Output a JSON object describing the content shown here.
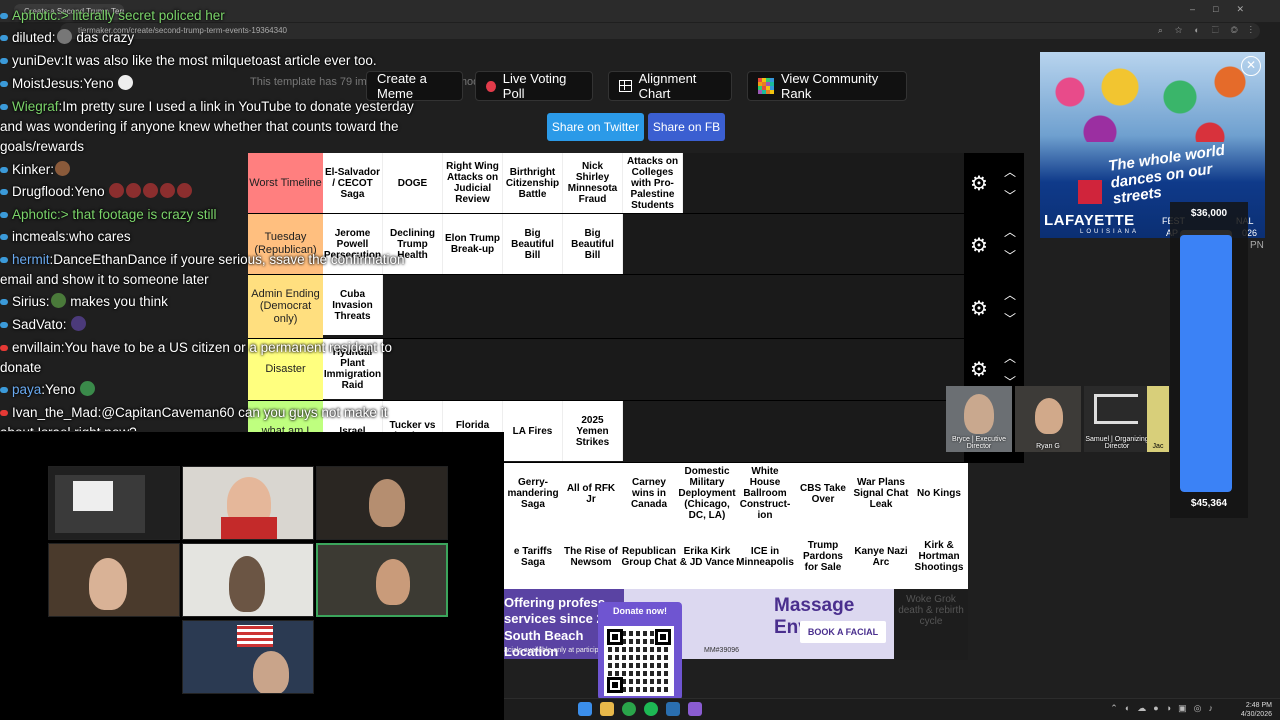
{
  "browser": {
    "tab_title": "Create a Second Trump Term E...",
    "url": "tiermaker.com/create/second-trump-term-events-19364340"
  },
  "page": {
    "template_note": "This template has 79 images and was last modified 04/10/2026.",
    "buttons": {
      "create_meme": "Create a Meme",
      "live_voting": "Live Voting Poll",
      "alignment_chart": "Alignment Chart",
      "community_rank": "View Community Rank",
      "share_twitter": "Share on Twitter",
      "share_fb": "Share on FB"
    },
    "tiers": [
      {
        "label": "Worst Timeline",
        "color": "#ff7f7f",
        "items": [
          "El-Salvador / CECOT Saga",
          "DOGE",
          "Right Wing Attacks on Judicial Review",
          "Birthright Citizenship Battle",
          "Nick Shirley Minnesota Fraud",
          "Attacks on Colleges with Pro-Palestine Students"
        ]
      },
      {
        "label": "Tuesday (Republican)",
        "color": "#ffbf7f",
        "items": [
          "Jerome Powell Persecution",
          "Declining Trump Health",
          "Elon Trump Break-up",
          "Big Beautiful Bill",
          "Big Beautiful Bill"
        ]
      },
      {
        "label": "Admin Ending (Democrat only)",
        "color": "#ffdf7f",
        "items": [
          "Cuba Invasion Threats"
        ]
      },
      {
        "label": "Disaster",
        "color": "#ffff7f",
        "items": [
          "Hyundai Plant Immigration Raid"
        ]
      },
      {
        "label": "what am I",
        "color": "#bfff7f",
        "items": [
          "Israel",
          "Tucker vs Shapiro @",
          "Florida Governor",
          "LA Fires",
          "2025 Yemen Strikes"
        ]
      }
    ],
    "bank_row1": [
      "Gerry-mandering Saga",
      "All of RFK Jr",
      "Carney wins in Canada",
      "Domestic Military Deployment (Chicago, DC, LA)",
      "White House Ballroom Construct-ion",
      "CBS Take Over",
      "War Plans Signal Chat Leak",
      "No Kings"
    ],
    "bank_row2": [
      "e Tariffs Saga",
      "The Rise of Newsom",
      "Republican Group Chat",
      "Erika Kirk & JD Vance",
      "ICE in Minneapolis",
      "Trump Pardons for Sale",
      "Kanye Nazi Arc",
      "Kirk & Hortman Shootings"
    ],
    "faded_item": "Woke Grok death & rebirth cycle"
  },
  "ad": {
    "left_text": "Offering profess services since 20 South Beach Location",
    "brand": "Massage Envy",
    "cta": "BOOK A FACIAL",
    "fine_print": "acials available only at particip",
    "ad_code": "MM#39096"
  },
  "donate": {
    "label": "Donate now!"
  },
  "poster": {
    "title": "The whole world dances on our streets",
    "city": "LAFAYETTE",
    "state": "LOUISIANA",
    "fest": "FEST",
    "fest_suffix": "NAL",
    "month": "AP",
    "year": "026"
  },
  "goal": {
    "top": "$36,000",
    "bottom": "$45,364",
    "fill_fraction": 0.98,
    "pn": "PN"
  },
  "cams": [
    {
      "name": "Bryce | Executive Director"
    },
    {
      "name": "Ryan G"
    },
    {
      "name": "Samuel | Organizing Director"
    },
    {
      "name": "Jac"
    }
  ],
  "chat": [
    {
      "user": "Aphotic",
      "sep": ":",
      "text": "> literally secret policed her",
      "kind": "green"
    },
    {
      "user": "diluted",
      "sep": ":",
      "text": "das crazy",
      "kind": "normal"
    },
    {
      "user": "yuniDev",
      "sep": ":",
      "text": "It was also like the most milquetoast article ever too.",
      "kind": "normal"
    },
    {
      "user": "MoistJesus",
      "sep": ":",
      "text": "Yeno",
      "kind": "normal"
    },
    {
      "user": "Wiegraf",
      "sep": ":",
      "text": "Im pretty sure I used a link in YouTube to donate yesterday and was wondering if anyone knew whether that counts toward the goals/rewards",
      "kind": "normal"
    },
    {
      "user": "Kinker",
      "sep": ":",
      "text": "",
      "kind": "normal"
    },
    {
      "user": "Drugflood",
      "sep": ":",
      "text": "Yeno",
      "kind": "normal"
    },
    {
      "user": "Aphotic",
      "sep": ":",
      "text": "> that footage is crazy still",
      "kind": "green"
    },
    {
      "user": "incmeals",
      "sep": ":",
      "text": "who cares",
      "kind": "normal"
    },
    {
      "user": "hermit",
      "sep": ":",
      "text": "DanceEthanDance if youre serious, ssave the confirmation email and show it to someone later",
      "kind": "normal"
    },
    {
      "user": "Sirius",
      "sep": ":",
      "text": "makes you think",
      "kind": "normal"
    },
    {
      "user": "SadVato",
      "sep": ":",
      "text": "",
      "kind": "normal"
    },
    {
      "user": "envillain",
      "sep": ":",
      "text": "You have to be a US citizen or a permanent resident to donate",
      "kind": "normal"
    },
    {
      "user": "paya",
      "sep": ":",
      "text": "Yeno",
      "kind": "normal"
    },
    {
      "user": "Ivan_the_Mad",
      "sep": ":",
      "text": "@CapitanCaveman60 can you guys not make it about Israel right now?",
      "kind": "normal"
    }
  ],
  "taskbar": {
    "time": "2:48 PM",
    "date": "4/30/2026"
  }
}
